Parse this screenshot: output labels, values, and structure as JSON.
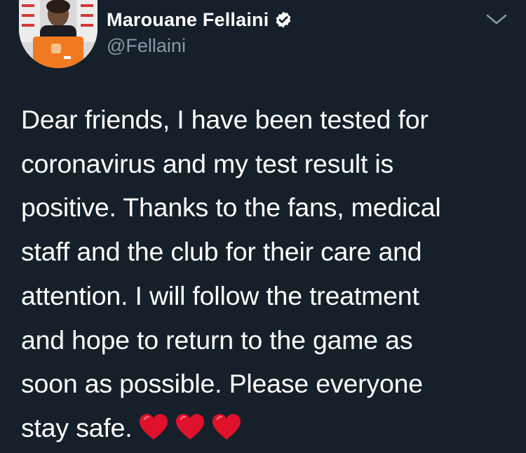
{
  "tweet": {
    "author": {
      "display_name": "Marouane Fellaini",
      "handle": "@Fellaini",
      "verified_icon": "verified-badge-icon"
    },
    "menu_icon": "chevron-down-icon",
    "text_lines": [
      "Dear friends, I have been tested for",
      "coronavirus and my test result is",
      "positive. Thanks to the fans, medical",
      "staff and the club for their care and",
      "attention. I will follow the treatment",
      "and hope to return to the game as",
      "soon as possible. Please everyone",
      "stay safe."
    ],
    "emoji": [
      "❤️",
      "❤️",
      "❤️"
    ],
    "emoji_icon": "red-heart-icon"
  },
  "colors": {
    "background": "#15202b",
    "text": "#ffffff",
    "secondary_text": "#8899a6",
    "heart": "#e0112a"
  }
}
